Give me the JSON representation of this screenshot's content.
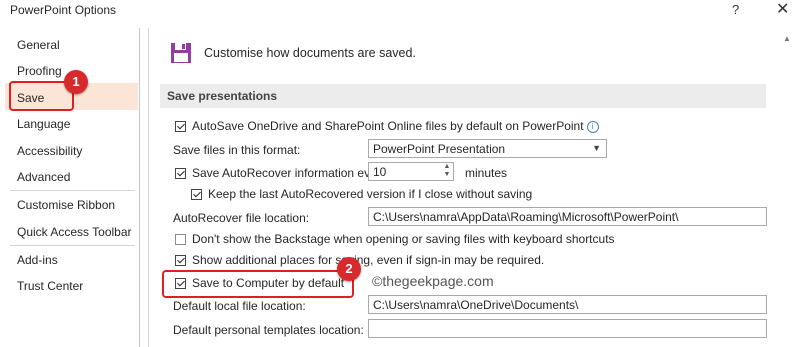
{
  "window": {
    "title": "PowerPoint Options",
    "help": "?",
    "close": "✕"
  },
  "sidebar": {
    "items": [
      {
        "label": "General"
      },
      {
        "label": "Proofing"
      },
      {
        "label": "Save"
      },
      {
        "label": "Language"
      },
      {
        "label": "Accessibility"
      },
      {
        "label": "Advanced"
      },
      {
        "label": "Customise Ribbon"
      },
      {
        "label": "Quick Access Toolbar"
      },
      {
        "label": "Add-ins"
      },
      {
        "label": "Trust Center"
      }
    ],
    "selected": "Save"
  },
  "callouts": {
    "badge1": "1",
    "badge2": "2"
  },
  "main": {
    "heading": "Customise how documents are saved.",
    "section_title": "Save presentations",
    "autosave_label": "AutoSave OneDrive and SharePoint Online files by default on PowerPoint",
    "autosave_checked": true,
    "format_label": "Save files in this format:",
    "format_value": "PowerPoint Presentation",
    "autorecover_label": "Save AutoRecover information every",
    "autorecover_checked": true,
    "autorecover_value": "10",
    "autorecover_unit": "minutes",
    "keep_last_label": "Keep the last AutoRecovered version if I close without saving",
    "keep_last_checked": true,
    "autorecover_location_label": "AutoRecover file location:",
    "autorecover_location_value": "C:\\Users\\namra\\AppData\\Roaming\\Microsoft\\PowerPoint\\",
    "backstage_label": "Don't show the Backstage when opening or saving files with keyboard shortcuts",
    "backstage_checked": false,
    "additional_places_label": "Show additional places for saving, even if sign-in may be required.",
    "additional_places_checked": true,
    "save_to_computer_label": "Save to Computer by default",
    "save_to_computer_checked": true,
    "default_local_label": "Default local file location:",
    "default_local_value": "C:\\Users\\namra\\OneDrive\\Documents\\",
    "personal_templates_label": "Default personal templates location:",
    "personal_templates_value": ""
  },
  "watermark": "©thegeekpage.com",
  "colors": {
    "callout_red": "#e02020",
    "badge_red": "#d8292c",
    "selected_bg": "#fbe5d6"
  }
}
